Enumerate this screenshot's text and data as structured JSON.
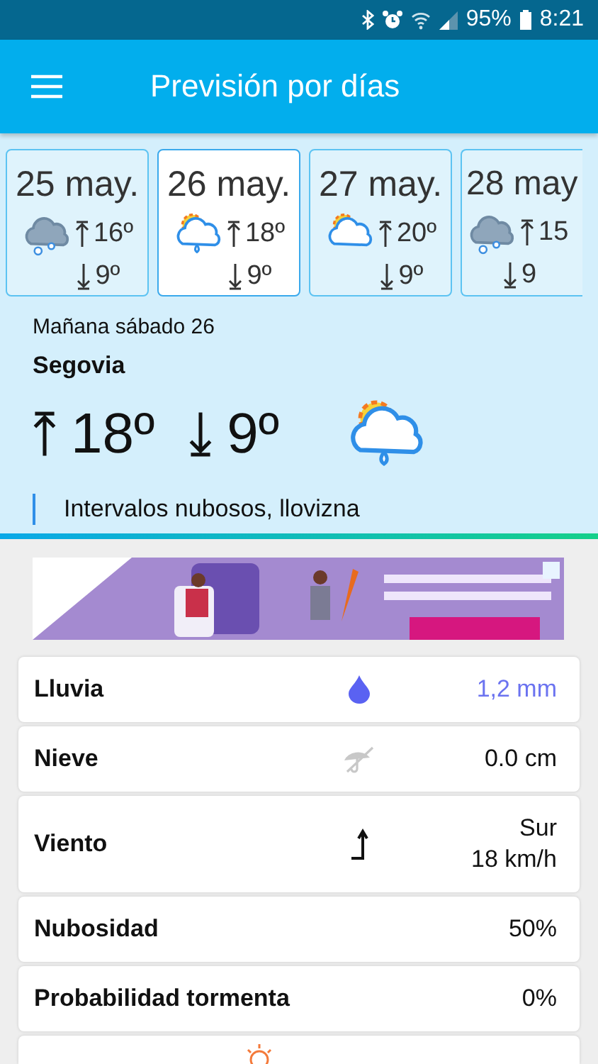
{
  "status_bar": {
    "battery": "95%",
    "time": "8:21"
  },
  "app_bar": {
    "title": "Previsión por días"
  },
  "days": [
    {
      "date": "25 may.",
      "high": "16º",
      "low": "9º",
      "kind": "showers",
      "selected": false
    },
    {
      "date": "26 may.",
      "high": "18º",
      "low": "9º",
      "kind": "drizzle",
      "selected": true
    },
    {
      "date": "27 may.",
      "high": "20º",
      "low": "9º",
      "kind": "partly-cloudy",
      "selected": false
    },
    {
      "date": "28 may",
      "high": "15",
      "low": "9",
      "kind": "showers",
      "selected": false
    }
  ],
  "today": {
    "day": "Mañana sábado 26",
    "place": "Segovia",
    "high": "18º",
    "low": "9º",
    "kind": "drizzle",
    "description": "Intervalos nubosos, llovizna"
  },
  "details": [
    {
      "label": "Lluvia",
      "kind": "rain",
      "value": [
        "1,2 mm"
      ],
      "highlighted": true
    },
    {
      "label": "Nieve",
      "kind": "snow",
      "value": [
        "0.0 cm"
      ],
      "highlighted": false
    },
    {
      "label": "Viento",
      "kind": "wind",
      "value": [
        "Sur",
        "18 km/h"
      ],
      "highlighted": false
    },
    {
      "label": "Nubosidad",
      "kind": "none",
      "value": [
        "50%"
      ],
      "highlighted": false
    },
    {
      "label": "Probabilidad tormenta",
      "kind": "none",
      "value": [
        "0%"
      ],
      "highlighted": false
    }
  ]
}
